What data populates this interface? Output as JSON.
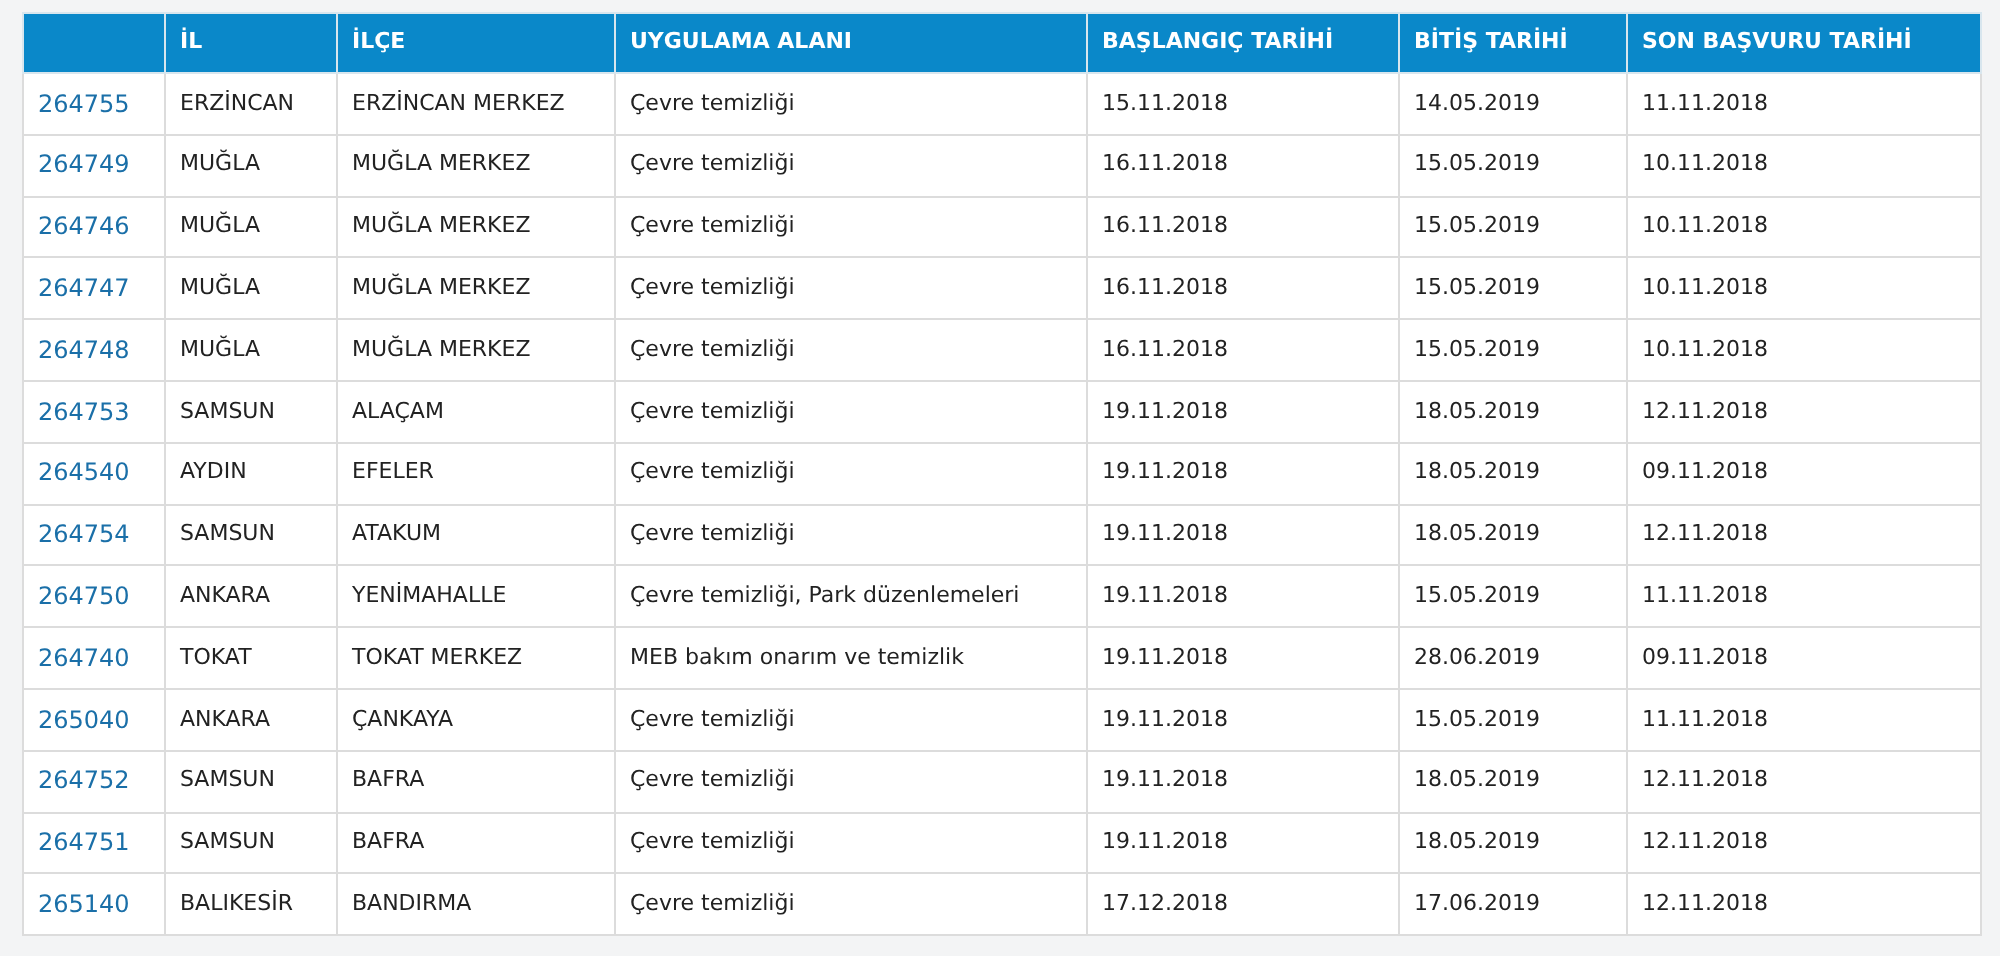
{
  "table": {
    "columns": [
      "",
      "İL",
      "İLÇE",
      "UYGULAMA ALANI",
      "BAŞLANGIÇ TARİHİ",
      "BİTİŞ TARİHİ",
      "SON BAŞVURU TARİHİ"
    ],
    "rows": [
      [
        "264755",
        "ERZİNCAN",
        "ERZİNCAN MERKEZ",
        "Çevre temizliği",
        "15.11.2018",
        "14.05.2019",
        "11.11.2018"
      ],
      [
        "264749",
        "MUĞLA",
        "MUĞLA MERKEZ",
        "Çevre temizliği",
        "16.11.2018",
        "15.05.2019",
        "10.11.2018"
      ],
      [
        "264746",
        "MUĞLA",
        "MUĞLA MERKEZ",
        "Çevre temizliği",
        "16.11.2018",
        "15.05.2019",
        "10.11.2018"
      ],
      [
        "264747",
        "MUĞLA",
        "MUĞLA MERKEZ",
        "Çevre temizliği",
        "16.11.2018",
        "15.05.2019",
        "10.11.2018"
      ],
      [
        "264748",
        "MUĞLA",
        "MUĞLA MERKEZ",
        "Çevre temizliği",
        "16.11.2018",
        "15.05.2019",
        "10.11.2018"
      ],
      [
        "264753",
        "SAMSUN",
        "ALAÇAM",
        "Çevre temizliği",
        "19.11.2018",
        "18.05.2019",
        "12.11.2018"
      ],
      [
        "264540",
        "AYDIN",
        "EFELER",
        "Çevre temizliği",
        "19.11.2018",
        "18.05.2019",
        "09.11.2018"
      ],
      [
        "264754",
        "SAMSUN",
        "ATAKUM",
        "Çevre temizliği",
        "19.11.2018",
        "18.05.2019",
        "12.11.2018"
      ],
      [
        "264750",
        "ANKARA",
        "YENİMAHALLE",
        "Çevre temizliği, Park düzenlemeleri",
        "19.11.2018",
        "15.05.2019",
        "11.11.2018"
      ],
      [
        "264740",
        "TOKAT",
        "TOKAT MERKEZ",
        "MEB bakım onarım ve temizlik",
        "19.11.2018",
        "28.06.2019",
        "09.11.2018"
      ],
      [
        "265040",
        "ANKARA",
        "ÇANKAYA",
        "Çevre temizliği",
        "19.11.2018",
        "15.05.2019",
        "11.11.2018"
      ],
      [
        "264752",
        "SAMSUN",
        "BAFRA",
        "Çevre temizliği",
        "19.11.2018",
        "18.05.2019",
        "12.11.2018"
      ],
      [
        "264751",
        "SAMSUN",
        "BAFRA",
        "Çevre temizliği",
        "19.11.2018",
        "18.05.2019",
        "12.11.2018"
      ],
      [
        "265140",
        "BALIKESİR",
        "BANDIRMA",
        "Çevre temizliği",
        "17.12.2018",
        "17.06.2019",
        "12.11.2018"
      ]
    ]
  }
}
